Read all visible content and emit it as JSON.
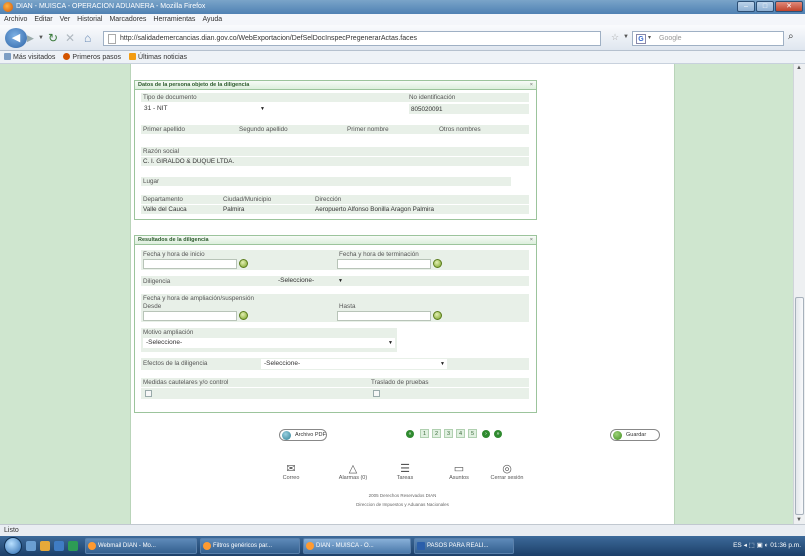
{
  "window": {
    "title": "DIAN - MUISCA - OPERACION ADUANERA - Mozilla Firefox"
  },
  "menu": [
    "Archivo",
    "Editar",
    "Ver",
    "Historial",
    "Marcadores",
    "Herramientas",
    "Ayuda"
  ],
  "nav": {
    "url": "http://salidademercancias.dian.gov.co/WebExportacion/DefSelDocInspecPregenerarActas.faces",
    "search_placeholder": "Google"
  },
  "bookmarks": [
    "Más visitados",
    "Primeros pasos",
    "Últimas noticias"
  ],
  "persona": {
    "header": "Datos de la persona objeto de la diligencia",
    "tipo_documento_label": "Tipo de documento",
    "tipo_documento_value": "31 - NIT",
    "no_identificacion_label": "No identificación",
    "no_identificacion_value": "805020091",
    "primer_apellido_label": "Primer apellido",
    "segundo_apellido_label": "Segundo apellido",
    "primer_nombre_label": "Primer nombre",
    "otros_nombres_label": "Otros nombres",
    "razon_social_label": "Razón social",
    "razon_social_value": "C. I. GIRALDO & DUQUE LTDA.",
    "lugar_label": "Lugar",
    "departamento_label": "Departamento",
    "departamento_value": "Valle del Cauca",
    "ciudad_label": "Ciudad/Municipio",
    "ciudad_value": "Palmira",
    "direccion_label": "Dirección",
    "direccion_value": "Aeropuerto Alfonso Bonilla Aragon Palmira"
  },
  "resultados": {
    "header": "Resultados de la diligencia",
    "fecha_inicio_label": "Fecha y hora de inicio",
    "fecha_terminacion_label": "Fecha y hora de terminación",
    "diligencia_label": "Diligencia",
    "diligencia_value": "-Seleccione-",
    "ampliacion_label": "Fecha y hora de ampliación/suspensión",
    "desde_label": "Desde",
    "hasta_label": "Hasta",
    "motivo_label": "Motivo ampliación",
    "motivo_value": "-Seleccione-",
    "efectos_label": "Efectos de la diligencia",
    "efectos_value": "-Seleccione-",
    "medidas_label": "Medidas cautelares y/o control",
    "traslado_label": "Traslado de pruebas"
  },
  "actions": {
    "archivo_pdf_label": "Archivo PDF",
    "guardar_label": "Guardar",
    "pages": [
      "1",
      "2",
      "3",
      "4",
      "5"
    ]
  },
  "footer": {
    "icons": [
      "Correo",
      "Alarmas (0)",
      "Tareas",
      "Asuntos",
      "Cerrar sesión"
    ],
    "copyright": "2005 Derechos Reservados DIAN",
    "entity": "Direccion de Impuestos y Aduanas Nacionales"
  },
  "status": "Listo",
  "taskbar": {
    "tasks": [
      "Webmail DIAN - Mo...",
      "Filtros genéricos par...",
      "DIAN - MUISCA - O...",
      "PASOS PARA REALI..."
    ],
    "tray_lang": "ES",
    "clock": "01:36 p.m."
  }
}
